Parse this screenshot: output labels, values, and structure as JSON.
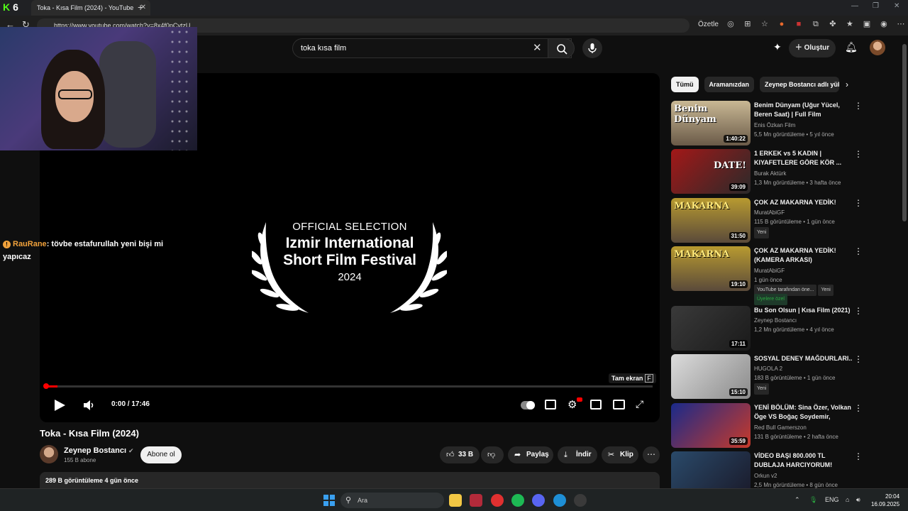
{
  "browser": {
    "tab_title": "Toka - Kısa Film (2024) - YouTube",
    "url": "https://www.youtube.com/watch?v=8x4f0pCvtzU",
    "summarize_label": "Özetle",
    "badge_count": "29"
  },
  "youtube": {
    "search_query": "toka kısa film",
    "create_label": "Oluştur"
  },
  "player": {
    "laurel_line1": "OFFICIAL SELECTION",
    "laurel_line2": "Izmir International",
    "laurel_line3": "Short Film Festival",
    "laurel_line4": "2024",
    "current_time": "0:00 / 17:46",
    "fullscreen_tooltip": "Tam ekran",
    "fullscreen_key": "F",
    "progress_fraction": 0.02
  },
  "chat": {
    "user": "RauRane",
    "message": ": tövbe estafurullah yeni bişi mi yapıcaz"
  },
  "video": {
    "title": "Toka - Kısa Film (2024)",
    "channel": "Zeynep Bostancı",
    "subscribers": "155 B abone",
    "subscribe_label": "Abone ol",
    "likes": "33 B",
    "share_label": "Paylaş",
    "download_label": "İndir",
    "clip_label": "Klip",
    "stats": "289 B görüntüleme  4 gün önce"
  },
  "sidebar": {
    "chips": [
      "Tümü",
      "Aramanızdan",
      "Zeynep Bostancı adlı yük"
    ],
    "recommendations": [
      {
        "title": "Benim Dünyam (Uğur Yücel, Beren Saat) | Full Film",
        "channel": "Enis Özkan Film",
        "meta": "5,5 Mn görüntüleme • 5 yıl önce",
        "duration": "1:40:22",
        "thumb_text": "Benim Dünyam",
        "badge": "",
        "extra": ""
      },
      {
        "title": "1 ERKEK vs 5 KADIN | KIYAFETLERE GÖRE KÖR ...",
        "channel": "Burak Aktürk",
        "meta": "1,3 Mn görüntüleme • 3 hafta önce",
        "duration": "39:09",
        "thumb_text": "DATE!",
        "badge": "",
        "extra": ""
      },
      {
        "title": "ÇOK AZ MAKARNA YEDİK!",
        "channel": "MuratAbiGF",
        "meta": "115 B görüntüleme • 1 gün önce",
        "duration": "31:50",
        "thumb_text": "MAKARNA",
        "badge": "Yeni",
        "extra": ""
      },
      {
        "title": "ÇOK AZ MAKARNA YEDİK! (KAMERA ARKASI)",
        "channel": "MuratAbiGF",
        "meta": "1 gün önce",
        "duration": "19:10",
        "thumb_text": "MAKARNA",
        "badge": "YouTube tarafından öne...",
        "badge2": "Yeni",
        "extra": "Üyelere özel"
      },
      {
        "title": "Bu Son Olsun | Kısa Film (2021)",
        "channel": "Zeynep Bostancı",
        "meta": "1,2 Mn görüntüleme • 4 yıl önce",
        "duration": "17:11",
        "thumb_text": "",
        "badge": "",
        "extra": ""
      },
      {
        "title": "SOSYAL DENEY MAĞDURLARI..",
        "channel": "HUGOLA 2",
        "meta": "183 B görüntüleme • 1 gün önce",
        "duration": "15:10",
        "thumb_text": "",
        "badge": "Yeni",
        "extra": ""
      },
      {
        "title": "YENİ BÖLÜM: Sina Özer, Volkan Öge VS Boğaç Soydemir, Chab...",
        "channel": "Red Bull Gamerszon",
        "meta": "131 B görüntüleme • 2 hafta önce",
        "duration": "35:59",
        "thumb_text": "",
        "badge": "",
        "extra": ""
      },
      {
        "title": "VİDEO BAŞI 800.000 TL DUBLAJA HARCIYORUM! Ruhi...",
        "channel": "Orkun v2",
        "meta": "2,5 Mn görüntüleme • 8 gün önce",
        "duration": "",
        "thumb_text": "",
        "badge": "",
        "extra": ""
      }
    ]
  },
  "taskbar": {
    "search_label": "Ara",
    "lang": "ENG",
    "time": "20:04",
    "date": "16.09.2025"
  },
  "colors": {
    "accent_red": "#ff0000",
    "kick_green": "#53fc18",
    "chat_user": "#f0a13b",
    "members_green": "#2ba640"
  }
}
